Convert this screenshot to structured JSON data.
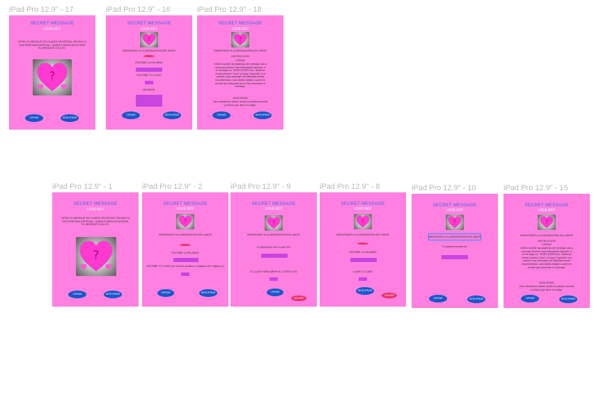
{
  "frames": {
    "f17": {
      "label": "iPad Pro 12.9\" - 17",
      "title": "SECRET MESSAGE",
      "sub": "LOVE KEY",
      "text1": "CIFRA TU MENSAJE EN CLAVES SECRETAS, ENVIALO A ESA PERSONA ESPECIAL, QUIEN PODRA DESCIFRAR EL MENSAJE OCULTO.",
      "btn_left": "CIFRAR",
      "btn_right": "DESCIFRAR"
    },
    "f16": {
      "label": "iPad Pro 12.9\" - 16",
      "title": "SECRET MESSAGE",
      "sub": "LOVE KEY",
      "welcome": "BIENVENIDO A LA MENSAJERIA DEL AMOR",
      "line1": "ESCRIBE LA PALABRA",
      "line2": "ESCRIBE TU CLAVE",
      "line3": "MENSAJE",
      "btn_left": "CIFRAR",
      "btn_right": "DESCIFRAR"
    },
    "f18": {
      "label": "iPad Pro 12.9\" - 18",
      "title": "SECRET MESSAGE",
      "sub": "LOVE KEY",
      "welcome": "BIENVENIDO A LA MENSAJERIA DEL AMOR",
      "heading": "INSTRUCCION",
      "cifrar": "CIFRAR",
      "para1": "Debes escribir las palabras del mensaje una a una para hacerlo mas interesante ejemplo: a el mensaje es: \"ERES ESPECIAL\" deberas enviar primero \"eres\" y luego \"especial\" a la quieres mas mensajes de dificultad enviar inscribiendolo, solo debes indicar a quien le envias que descubre (en el libre descubre el mensaje.",
      "descifrar": "DESCIFRAR",
      "para2": "Para descifrarlo debes recibir la palabra secreta y la llave que abre el codigo.",
      "btn_left": "CIFRAR",
      "btn_right": "DESCIFRAR"
    },
    "f1": {
      "label": "iPad Pro 12.9\" - 1",
      "title": "SECRET MESSAGE",
      "sub": "LOVE KEY",
      "text1": "CIFRA TU MENSAJE EN CLAVES SECRETAS, ENVIALO A ESA PERSONA ESPECIAL, QUIEN PODRA DESCIFRAR EL MENSAJE OCULTO.",
      "btn_left": "CIFRAR",
      "btn_right": "DESCIFRAR"
    },
    "f2": {
      "label": "iPad Pro 12.9\" - 2",
      "title": "SECRET MESSAGE",
      "sub": "LOVE KEY",
      "welcome": "BIENVENIDO A LA MENSAJERIA DEL AMOR",
      "line1": "ESCRIBE LA PALABRA",
      "line2": "ESCRIBE 1Z CLAVE (un numero positivo o negativo de 4 digitos p.)",
      "btn_left": "CIFRAR",
      "btn_right": "DESCIFRAR"
    },
    "f9": {
      "label": "iPad Pro 12.9\" - 9",
      "title": "SECRET MESSAGE",
      "sub": "LOVE KEY",
      "welcome": "BIENVENIDO A LA MENSAJERIA DEL AMOR",
      "line1": "TU MENSAJE EN CLAVE ES:",
      "line2": "TU LLAVE PARA ABRIR EL CODIGO ES:",
      "btn_left": "CIFRAR",
      "btn_right": "VOLVER"
    },
    "f8": {
      "label": "iPad Pro 12.9\" - 8",
      "title": "SECRET MESSAGE",
      "sub": "LOVE KEY",
      "welcome": "BIENVENIDO A LA MENSAJERIA DEL AMOR",
      "line1": "ESCRIBE LA PALABRA",
      "line2": "LLAVE O CLAVE",
      "btn_left": "DESCIFRAR",
      "btn_right": "VOLVER"
    },
    "f10": {
      "label": "iPad Pro 12.9\" - 10",
      "title": "SECRET MESSAGE",
      "sub": "LOVE KEY",
      "welcome": "BIENVENIDO A LA MENSAJERIA DEL AMOR",
      "line1": "Tu palabra secreta es:",
      "btn_left": "CIFRAR",
      "btn_right": "DESCIFRAR"
    },
    "f15": {
      "label": "iPad Pro 12.9\" - 15",
      "title": "SECRET MESSAGE",
      "sub": "LOVE KEY",
      "welcome": "BIENVENIDO A LA MENSAJERIA DEL AMOR",
      "heading": "INSTRUCCION",
      "cifrar": "CIFRAR",
      "para1": "Debes escribir las palabras del mensaje una a una para hacerlo mas interesante ejemplo: a el mensaje es: \"ERES ESPECIAL\" deberas enviar primero \"eres\" y luego \"especial\" a la quieres mas mensajes de dificultad enviar inscribiendolo, solo debes indicar a quien le envias que descubre el mensaje.",
      "descifrar": "DESCIFRAR",
      "para2": "Para descifrarlo debes recibir la palabra secreta y la llave que abre el codigo.",
      "btn_left": "CIFRAR",
      "btn_right": "DESCIFRAR"
    }
  },
  "colors": {
    "frame_bg": "#ff80e0",
    "title": "#3a64e8",
    "button": "#1a56c8",
    "button_alt": "#e8306a",
    "input": "#c845e0"
  }
}
